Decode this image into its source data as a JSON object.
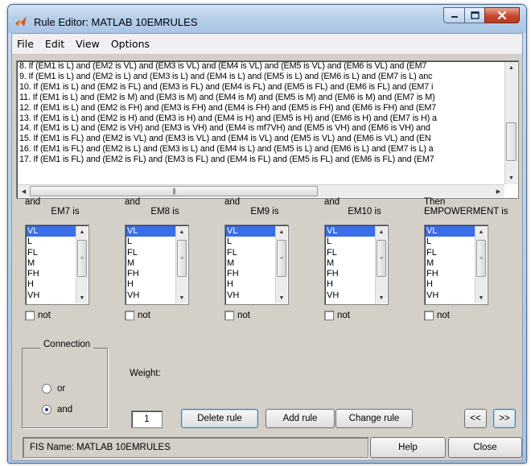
{
  "window": {
    "title": "Rule Editor: MATLAB 10EMRULES"
  },
  "menu": [
    "File",
    "Edit",
    "View",
    "Options"
  ],
  "rules": [
    "8. If (EM1 is L) and (EM2 is VL) and (EM3 is VL) and (EM4 is VL) and (EM5 is VL) and (EM6 is VL) and (EM7",
    "9. If (EM1 is L) and (EM2 is L) and (EM3 is L) and (EM4 is L) and (EM5 is L) and (EM6 is L) and (EM7 is L) anc",
    "10. If (EM1 is L) and (EM2 is FL) and (EM3 is FL) and (EM4 is FL) and (EM5 is FL) and (EM6 is FL) and (EM7 i",
    "11. If (EM1 is L) and (EM2 is M) and (EM3 is M) and (EM4 is M) and (EM5 is M) and (EM6 is M) and (EM7 is M)",
    "12. If (EM1 is L) and (EM2 is FH) and (EM3 is FH) and (EM4 is FH) and (EM5 is FH) and (EM6 is FH) and (EM7",
    "13. If (EM1 is L) and (EM2 is H) and (EM3 is H) and (EM4 is H) and (EM5 is H) and (EM6 is H) and (EM7 is H) a",
    "14. If (EM1 is L) and (EM2 is VH) and (EM3 is VH) and (EM4 is mf7VH) and (EM5 is VH) and (EM6 is VH) and",
    "15. If (EM1 is FL) and (EM2 is VL) and (EM3 is VL) and (EM4 is VL) and (EM5 is VL) and (EM6 is VL) and (EN",
    "16. If (EM1 is FL) and (EM2 is L) and (EM3 is L) and (EM4 is L) and (EM5 is L) and (EM6 is L) and (EM7 is L) a",
    "17. If (EM1 is FL) and (EM2 is FL) and (EM3 is FL) and (EM4 is FL) and (EM5 is FL) and (EM6 is FL) and (EM7"
  ],
  "columns": [
    {
      "connector": "and",
      "name": "EM7 is",
      "options": [
        "VL",
        "L",
        "FL",
        "M",
        "FH",
        "H",
        "VH"
      ],
      "selected": "VL",
      "not_label": "not"
    },
    {
      "connector": "and",
      "name": "EM8 is",
      "options": [
        "VL",
        "L",
        "FL",
        "M",
        "FH",
        "H",
        "VH"
      ],
      "selected": "VL",
      "not_label": "not"
    },
    {
      "connector": "and",
      "name": "EM9 is",
      "options": [
        "VL",
        "L",
        "FL",
        "M",
        "FH",
        "H",
        "VH"
      ],
      "selected": "VL",
      "not_label": "not"
    },
    {
      "connector": "and",
      "name": "EM10 is",
      "options": [
        "VL",
        "L",
        "FL",
        "M",
        "FH",
        "H",
        "VH"
      ],
      "selected": "VL",
      "not_label": "not"
    },
    {
      "connector": "Then",
      "name": "EMPOWERMENT is",
      "options": [
        "VL",
        "L",
        "FL",
        "M",
        "FH",
        "H",
        "VH"
      ],
      "selected": "VL",
      "not_label": "not"
    }
  ],
  "connection": {
    "label": "Connection",
    "or_label": "or",
    "and_label": "and",
    "selected": "and"
  },
  "weight": {
    "label": "Weight:",
    "value": "1"
  },
  "buttons": {
    "delete_rule": "Delete rule",
    "add_rule": "Add rule",
    "change_rule": "Change rule",
    "prev": "<<",
    "next": ">>",
    "help": "Help",
    "close": "Close"
  },
  "status": "FIS Name: MATLAB 10EMRULES",
  "colors": {
    "selection": "#3a6ee8",
    "panel": "#d4d0c8",
    "title_gradient": "#b7cfea",
    "close_red": "#c9462c"
  }
}
